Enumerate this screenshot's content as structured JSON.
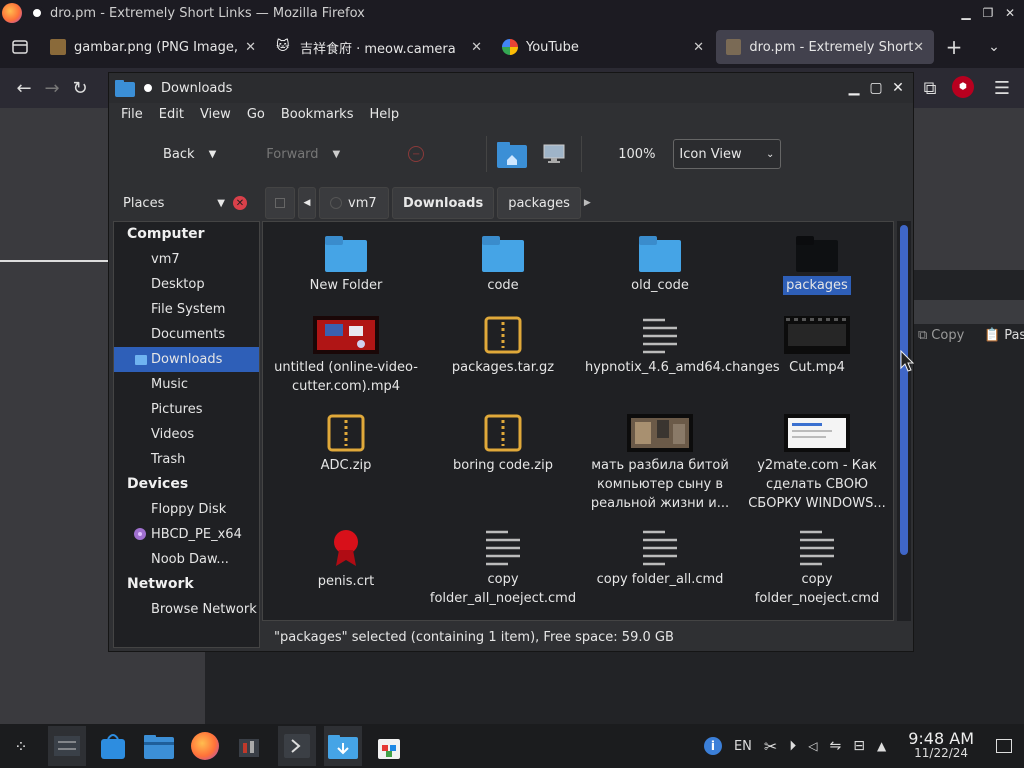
{
  "firefox": {
    "window_title": "dro.pm - Extremely Short Links — Mozilla Firefox",
    "tabs": [
      {
        "label": "gambar.png (PNG Image, ",
        "close": "✕"
      },
      {
        "label": "吉祥食府 · meow.camera",
        "close": "✕"
      },
      {
        "label": "YouTube",
        "close": "✕"
      },
      {
        "label": "dro.pm - Extremely Short L",
        "close": "✕"
      }
    ],
    "page_toolbar": {
      "copy_label": "Copy",
      "paste_label": "Pas"
    }
  },
  "file_manager": {
    "title": "Downloads",
    "menu": [
      "File",
      "Edit",
      "View",
      "Go",
      "Bookmarks",
      "Help"
    ],
    "toolbar": {
      "back_label": "Back",
      "forward_label": "Forward",
      "zoom": "100%",
      "view_mode": "Icon View"
    },
    "places_label": "Places",
    "breadcrumbs": [
      "vm7",
      "Downloads",
      "packages"
    ],
    "sidebar": {
      "computer": {
        "heading": "Computer",
        "items": [
          "vm7",
          "Desktop",
          "File System",
          "Documents",
          "Downloads",
          "Music",
          "Pictures",
          "Videos",
          "Trash"
        ]
      },
      "devices": {
        "heading": "Devices",
        "items": [
          "Floppy Disk",
          "HBCD_PE_x64",
          "Noob Daw..."
        ]
      },
      "network": {
        "heading": "Network",
        "items": [
          "Browse Network"
        ]
      }
    },
    "files": [
      {
        "name": "New Folder",
        "type": "folder"
      },
      {
        "name": "code",
        "type": "folder"
      },
      {
        "name": "old_code",
        "type": "folder"
      },
      {
        "name": "packages",
        "type": "folder-selected"
      },
      {
        "name": "untitled (online-video-cutter.com).mp4",
        "type": "video-red"
      },
      {
        "name": "packages.tar.gz",
        "type": "archive"
      },
      {
        "name": "hypnotix_4.6_amd64.changes",
        "type": "text"
      },
      {
        "name": "Cut.mp4",
        "type": "video-dark"
      },
      {
        "name": "ADC.zip",
        "type": "archive"
      },
      {
        "name": "boring code.zip",
        "type": "archive"
      },
      {
        "name": "мать разбила битой компьютер сыну в реальной жизни и...",
        "type": "video-photo"
      },
      {
        "name": "y2mate.com - Как сделать СВОЮ СБОРКУ WINDOWS...",
        "type": "video-screen"
      },
      {
        "name": "penis.crt",
        "type": "certificate"
      },
      {
        "name": "copy folder_all_noeject.cmd",
        "type": "text"
      },
      {
        "name": "copy folder_all.cmd",
        "type": "text"
      },
      {
        "name": "copy folder_noeject.cmd",
        "type": "text"
      }
    ],
    "status": "\"packages\" selected (containing 1 item), Free space: 59.0 GB"
  },
  "taskbar": {
    "lang": "EN",
    "time": "9:48 AM",
    "date": "11/22/24"
  }
}
